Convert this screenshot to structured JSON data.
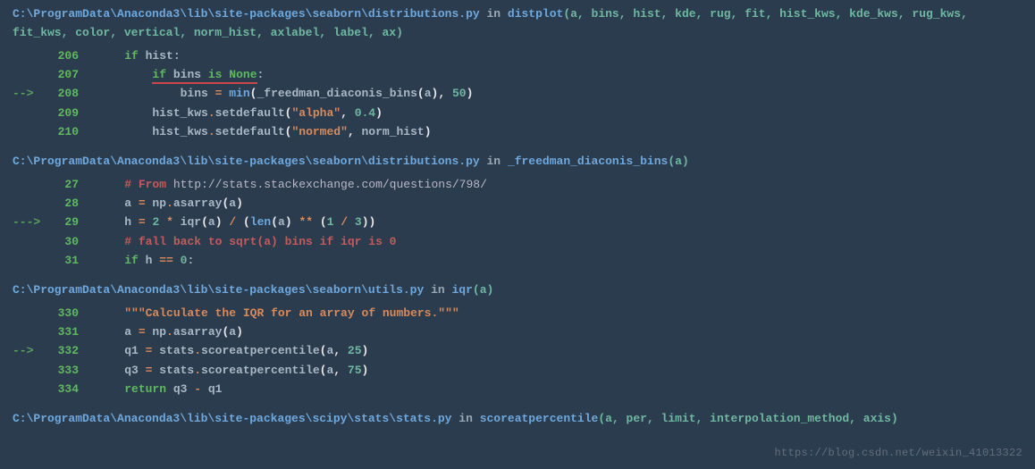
{
  "frames": [
    {
      "path": "C:\\ProgramData\\Anaconda3\\lib\\site-packages\\seaborn\\distributions.py",
      "in_word": "in",
      "func": "distplot",
      "params": "(a, bins, hist, kde, rug, fit, hist_kws, kde_kws, rug_kws, fit_kws, color, vertical, norm_hist, axlabel, label, ax)",
      "lines": [
        {
          "arrow": "",
          "n": "206",
          "tokens": [
            {
              "t": "    ",
              "c": ""
            },
            {
              "t": "if",
              "c": "c-kw"
            },
            {
              "t": " hist:",
              "c": "c-ident"
            }
          ]
        },
        {
          "arrow": "",
          "n": "207",
          "tokens": [
            {
              "t": "        ",
              "c": ""
            },
            {
              "t": "if",
              "c": "c-kw",
              "u": true
            },
            {
              "t": " ",
              "c": "",
              "u": true
            },
            {
              "t": "bins",
              "c": "c-ident",
              "u": true
            },
            {
              "t": " ",
              "c": "",
              "u": true
            },
            {
              "t": "is",
              "c": "c-kw",
              "u": true
            },
            {
              "t": " ",
              "c": "",
              "u": true
            },
            {
              "t": "None",
              "c": "c-kw",
              "u": true
            },
            {
              "t": ":",
              "c": "c-ident"
            }
          ]
        },
        {
          "arrow": "-->",
          "n": "208",
          "tokens": [
            {
              "t": "            bins ",
              "c": "c-ident"
            },
            {
              "t": "=",
              "c": "c-op"
            },
            {
              "t": " ",
              "c": ""
            },
            {
              "t": "min",
              "c": "c-builtin"
            },
            {
              "t": "(",
              "c": "c-white"
            },
            {
              "t": "_freedman_diaconis_bins",
              "c": "c-ident"
            },
            {
              "t": "(",
              "c": "c-white"
            },
            {
              "t": "a",
              "c": "c-ident"
            },
            {
              "t": ")",
              "c": "c-white"
            },
            {
              "t": ",",
              "c": "c-white"
            },
            {
              "t": " ",
              "c": ""
            },
            {
              "t": "50",
              "c": "c-num"
            },
            {
              "t": ")",
              "c": "c-white"
            }
          ]
        },
        {
          "arrow": "",
          "n": "209",
          "tokens": [
            {
              "t": "        hist_kws",
              "c": "c-ident"
            },
            {
              "t": ".",
              "c": "c-op"
            },
            {
              "t": "setdefault",
              "c": "c-ident"
            },
            {
              "t": "(",
              "c": "c-white"
            },
            {
              "t": "\"alpha\"",
              "c": "c-str"
            },
            {
              "t": ",",
              "c": "c-white"
            },
            {
              "t": " ",
              "c": ""
            },
            {
              "t": "0.4",
              "c": "c-num"
            },
            {
              "t": ")",
              "c": "c-white"
            }
          ]
        },
        {
          "arrow": "",
          "n": "210",
          "tokens": [
            {
              "t": "        hist_kws",
              "c": "c-ident"
            },
            {
              "t": ".",
              "c": "c-op"
            },
            {
              "t": "setdefault",
              "c": "c-ident"
            },
            {
              "t": "(",
              "c": "c-white"
            },
            {
              "t": "\"normed\"",
              "c": "c-str"
            },
            {
              "t": ",",
              "c": "c-white"
            },
            {
              "t": " norm_hist",
              "c": "c-ident"
            },
            {
              "t": ")",
              "c": "c-white"
            }
          ]
        }
      ]
    },
    {
      "path": "C:\\ProgramData\\Anaconda3\\lib\\site-packages\\seaborn\\distributions.py",
      "in_word": "in",
      "func": "_freedman_diaconis_bins",
      "params": "(a)",
      "lines": [
        {
          "arrow": "",
          "n": "27",
          "tokens": [
            {
              "t": "    ",
              "c": ""
            },
            {
              "t": "# From ",
              "c": "c-comment"
            },
            {
              "t": "http://stats.stackexchange.com/questions/798/",
              "c": "c-url"
            }
          ]
        },
        {
          "arrow": "",
          "n": "28",
          "tokens": [
            {
              "t": "    a ",
              "c": "c-ident"
            },
            {
              "t": "=",
              "c": "c-op"
            },
            {
              "t": " np",
              "c": "c-ident"
            },
            {
              "t": ".",
              "c": "c-op"
            },
            {
              "t": "asarray",
              "c": "c-ident"
            },
            {
              "t": "(",
              "c": "c-white"
            },
            {
              "t": "a",
              "c": "c-ident"
            },
            {
              "t": ")",
              "c": "c-white"
            }
          ]
        },
        {
          "arrow": "--->",
          "n": "29",
          "tokens": [
            {
              "t": "    h ",
              "c": "c-ident"
            },
            {
              "t": "=",
              "c": "c-op"
            },
            {
              "t": " ",
              "c": ""
            },
            {
              "t": "2",
              "c": "c-num"
            },
            {
              "t": " ",
              "c": ""
            },
            {
              "t": "*",
              "c": "c-op"
            },
            {
              "t": " iqr",
              "c": "c-ident"
            },
            {
              "t": "(",
              "c": "c-white"
            },
            {
              "t": "a",
              "c": "c-ident"
            },
            {
              "t": ")",
              "c": "c-white"
            },
            {
              "t": " ",
              "c": ""
            },
            {
              "t": "/",
              "c": "c-op"
            },
            {
              "t": " ",
              "c": ""
            },
            {
              "t": "(",
              "c": "c-white"
            },
            {
              "t": "len",
              "c": "c-builtin"
            },
            {
              "t": "(",
              "c": "c-white"
            },
            {
              "t": "a",
              "c": "c-ident"
            },
            {
              "t": ")",
              "c": "c-white"
            },
            {
              "t": " ",
              "c": ""
            },
            {
              "t": "**",
              "c": "c-op"
            },
            {
              "t": " ",
              "c": ""
            },
            {
              "t": "(",
              "c": "c-white"
            },
            {
              "t": "1",
              "c": "c-num"
            },
            {
              "t": " ",
              "c": ""
            },
            {
              "t": "/",
              "c": "c-op"
            },
            {
              "t": " ",
              "c": ""
            },
            {
              "t": "3",
              "c": "c-num"
            },
            {
              "t": "))",
              "c": "c-white"
            }
          ]
        },
        {
          "arrow": "",
          "n": "30",
          "tokens": [
            {
              "t": "    ",
              "c": ""
            },
            {
              "t": "# fall back to sqrt(a) bins if iqr is 0",
              "c": "c-comment"
            }
          ]
        },
        {
          "arrow": "",
          "n": "31",
          "tokens": [
            {
              "t": "    ",
              "c": ""
            },
            {
              "t": "if",
              "c": "c-kw"
            },
            {
              "t": " h ",
              "c": "c-ident"
            },
            {
              "t": "==",
              "c": "c-op"
            },
            {
              "t": " ",
              "c": ""
            },
            {
              "t": "0",
              "c": "c-num"
            },
            {
              "t": ":",
              "c": "c-ident"
            }
          ]
        }
      ]
    },
    {
      "path": "C:\\ProgramData\\Anaconda3\\lib\\site-packages\\seaborn\\utils.py",
      "in_word": "in",
      "func": "iqr",
      "params": "(a)",
      "lines": [
        {
          "arrow": "",
          "n": "330",
          "tokens": [
            {
              "t": "    ",
              "c": ""
            },
            {
              "t": "\"\"\"Calculate the IQR for an array of numbers.\"\"\"",
              "c": "c-str"
            }
          ]
        },
        {
          "arrow": "",
          "n": "331",
          "tokens": [
            {
              "t": "    a ",
              "c": "c-ident"
            },
            {
              "t": "=",
              "c": "c-op"
            },
            {
              "t": " np",
              "c": "c-ident"
            },
            {
              "t": ".",
              "c": "c-op"
            },
            {
              "t": "asarray",
              "c": "c-ident"
            },
            {
              "t": "(",
              "c": "c-white"
            },
            {
              "t": "a",
              "c": "c-ident"
            },
            {
              "t": ")",
              "c": "c-white"
            }
          ]
        },
        {
          "arrow": "-->",
          "n": "332",
          "tokens": [
            {
              "t": "    q1 ",
              "c": "c-ident"
            },
            {
              "t": "=",
              "c": "c-op"
            },
            {
              "t": " stats",
              "c": "c-ident"
            },
            {
              "t": ".",
              "c": "c-op"
            },
            {
              "t": "scoreatpercentile",
              "c": "c-ident"
            },
            {
              "t": "(",
              "c": "c-white"
            },
            {
              "t": "a",
              "c": "c-ident"
            },
            {
              "t": ",",
              "c": "c-white"
            },
            {
              "t": " ",
              "c": ""
            },
            {
              "t": "25",
              "c": "c-num"
            },
            {
              "t": ")",
              "c": "c-white"
            }
          ]
        },
        {
          "arrow": "",
          "n": "333",
          "tokens": [
            {
              "t": "    q3 ",
              "c": "c-ident"
            },
            {
              "t": "=",
              "c": "c-op"
            },
            {
              "t": " stats",
              "c": "c-ident"
            },
            {
              "t": ".",
              "c": "c-op"
            },
            {
              "t": "scoreatpercentile",
              "c": "c-ident"
            },
            {
              "t": "(",
              "c": "c-white"
            },
            {
              "t": "a",
              "c": "c-ident"
            },
            {
              "t": ",",
              "c": "c-white"
            },
            {
              "t": " ",
              "c": ""
            },
            {
              "t": "75",
              "c": "c-num"
            },
            {
              "t": ")",
              "c": "c-white"
            }
          ]
        },
        {
          "arrow": "",
          "n": "334",
          "tokens": [
            {
              "t": "    ",
              "c": ""
            },
            {
              "t": "return",
              "c": "c-kw"
            },
            {
              "t": " q3 ",
              "c": "c-ident"
            },
            {
              "t": "-",
              "c": "c-op"
            },
            {
              "t": " q1",
              "c": "c-ident"
            }
          ]
        }
      ]
    },
    {
      "path": "C:\\ProgramData\\Anaconda3\\lib\\site-packages\\scipy\\stats\\stats.py",
      "in_word": "in",
      "func": "scoreatpercentile",
      "params": "(a, per, limit, interpolation_method, axis)",
      "lines": []
    }
  ],
  "watermark": "https://blog.csdn.net/weixin_41013322"
}
